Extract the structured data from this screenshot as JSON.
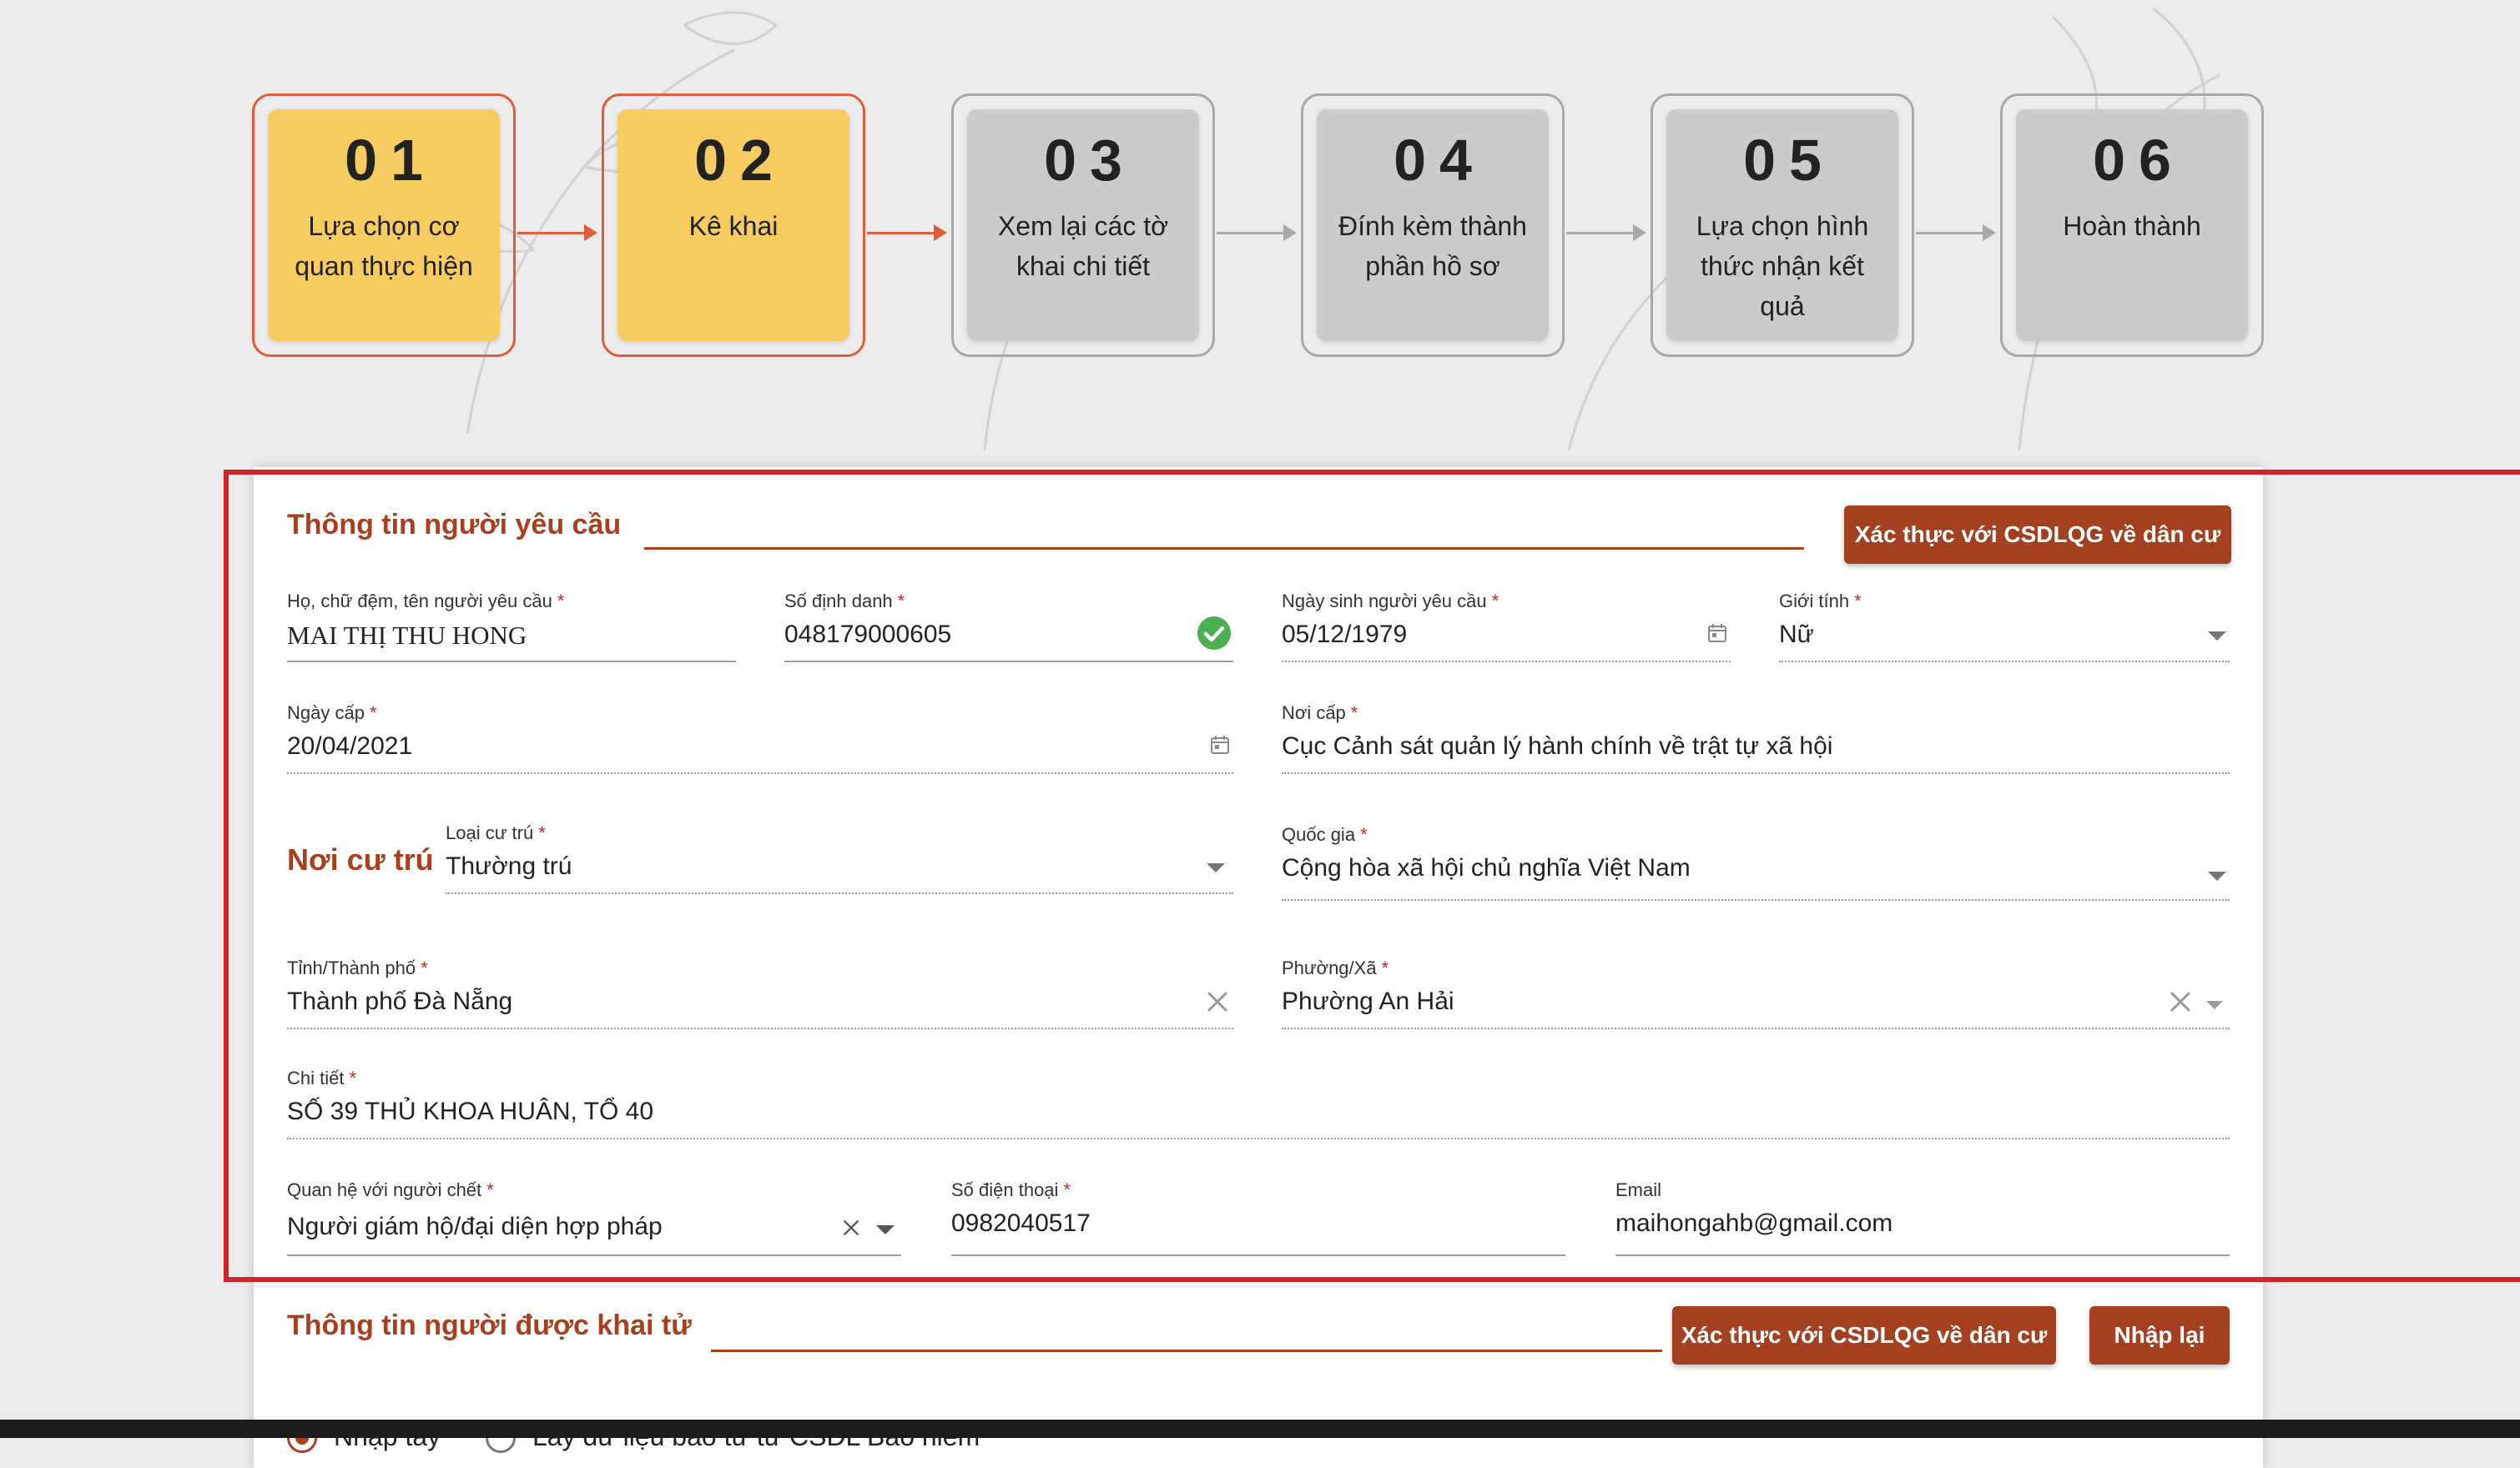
{
  "stepper": {
    "steps": [
      {
        "num": "01",
        "label": "Lựa chọn cơ quan thực hiện",
        "status": "done"
      },
      {
        "num": "02",
        "label": "Kê khai",
        "status": "done"
      },
      {
        "num": "03",
        "label": "Xem lại các tờ khai chi tiết",
        "status": "todo"
      },
      {
        "num": "04",
        "label": "Đính kèm thành phần hồ sơ",
        "status": "todo"
      },
      {
        "num": "05",
        "label": "Lựa chọn hình thức nhận kết quả",
        "status": "todo"
      },
      {
        "num": "06",
        "label": "Hoàn thành",
        "status": "todo"
      }
    ]
  },
  "requester": {
    "title": "Thông tin người yêu cầu",
    "verify_button": "Xác thực với CSDLQG về dân cư",
    "full_name": {
      "label": "Họ, chữ đệm, tên người yêu cầu",
      "value": "MAI THỊ THU HONG"
    },
    "id_number": {
      "label": "Số định danh",
      "value": "048179000605"
    },
    "birth_date": {
      "label": "Ngày sinh người yêu cầu",
      "value": "05/12/1979"
    },
    "gender": {
      "label": "Giới tính",
      "value": "Nữ"
    },
    "issue_date": {
      "label": "Ngày cấp",
      "value": "20/04/2021"
    },
    "issue_place": {
      "label": "Nơi cấp",
      "value": "Cục Cảnh sát quản lý hành chính về trật tự xã hội"
    },
    "residence": {
      "heading": "Nơi cư trú",
      "type": {
        "label": "Loại cư trú",
        "value": "Thường trú"
      },
      "country": {
        "label": "Quốc gia",
        "value": "Cộng hòa xã hội chủ nghĩa Việt Nam"
      },
      "province": {
        "label": "Tỉnh/Thành phố",
        "value": "Thành phố Đà Nẵng"
      },
      "ward": {
        "label": "Phường/Xã",
        "value": "Phường An Hải"
      },
      "detail": {
        "label": "Chi tiết",
        "value": "SỐ 39 THỦ KHOA HUÂN, TỔ 40"
      }
    },
    "relation": {
      "label": "Quan hệ với người chết",
      "value": "Người giám hộ/đại diện hợp pháp"
    },
    "phone": {
      "label": "Số điện thoại",
      "value": "0982040517"
    },
    "email": {
      "label": "Email",
      "value": "maihongahb@gmail.com"
    }
  },
  "deceased": {
    "title": "Thông tin người được khai tử",
    "verify_button": "Xác thực với CSDLQG về dân cư",
    "reset_button": "Nhập lại",
    "options": [
      "Nhập tay",
      "Lấy dữ liệu báo tử từ CSDL Bảo hiểm"
    ]
  },
  "colors": {
    "accent": "#a8401f",
    "step_done": "#f6cb5f",
    "step_todo": "#cbcbcb",
    "highlight": "#d1232a",
    "valid": "#4caf50"
  },
  "icons": [
    "check-circle-icon",
    "calendar-icon",
    "dropdown-arrow-icon",
    "clear-icon"
  ]
}
